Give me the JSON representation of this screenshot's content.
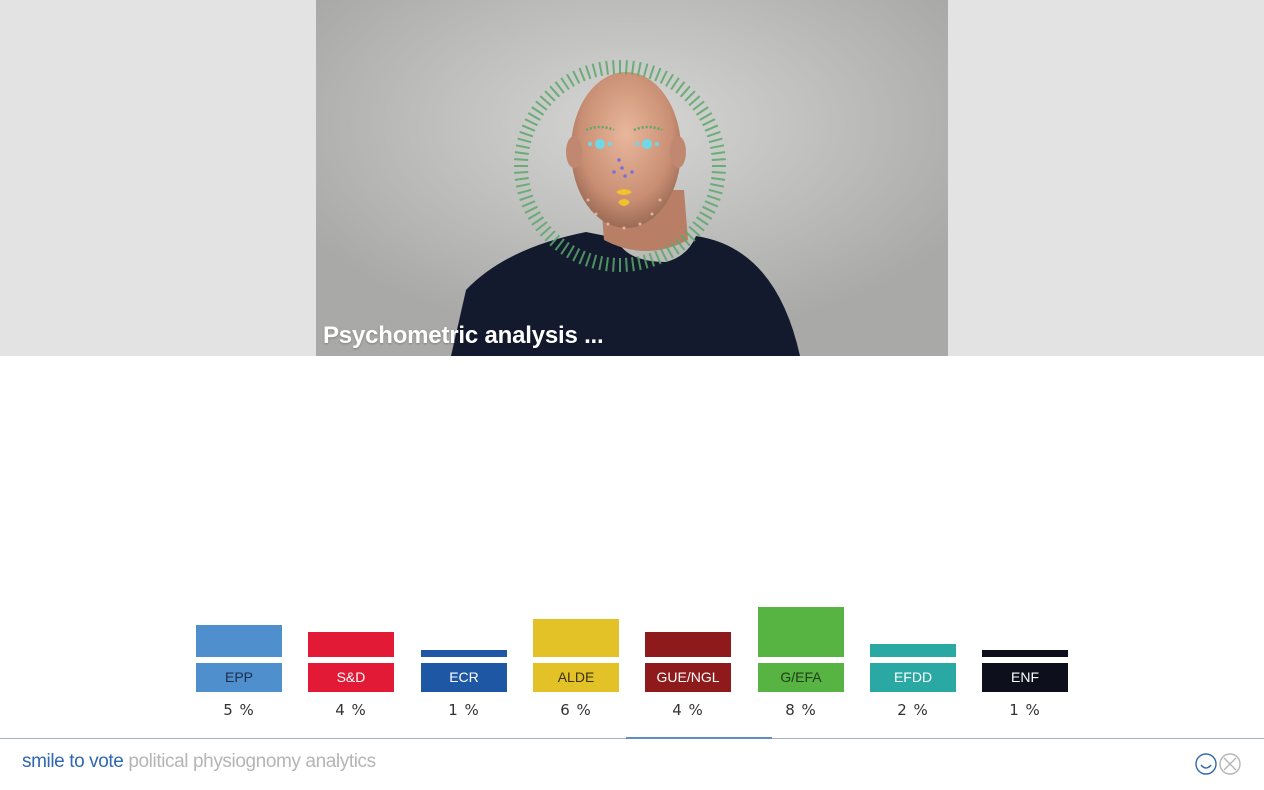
{
  "video": {
    "caption": "Psychometric analysis ...",
    "overlay_color": "#5aa86a"
  },
  "chart_data": {
    "type": "bar",
    "categories": [
      "EPP",
      "S&D",
      "ECR",
      "ALDE",
      "GUE/NGL",
      "G/EFA",
      "EFDD",
      "ENF"
    ],
    "values": [
      5,
      4,
      1,
      6,
      4,
      8,
      2,
      1
    ],
    "value_labels": [
      "5 %",
      "4 %",
      "1 %",
      "6 %",
      "4 %",
      "8 %",
      "2 %",
      "1 %"
    ],
    "colors": [
      "#4f8fce",
      "#e31a36",
      "#1e57a4",
      "#e3c227",
      "#8e1a1b",
      "#57b443",
      "#2aa8a3",
      "#0d0f1c"
    ],
    "label_text_colors": [
      "#1d2e4a",
      "#ffffff",
      "#ffffff",
      "#3a3210",
      "#ffffff",
      "#1f3a17",
      "#ffffff",
      "#ffffff"
    ],
    "title": "",
    "xlabel": "",
    "ylabel": ""
  },
  "footer": {
    "brand_name": "smile to vote",
    "brand_tagline": "political physiognomy analytics",
    "icons": [
      "smiley-icon",
      "close-icon"
    ]
  }
}
